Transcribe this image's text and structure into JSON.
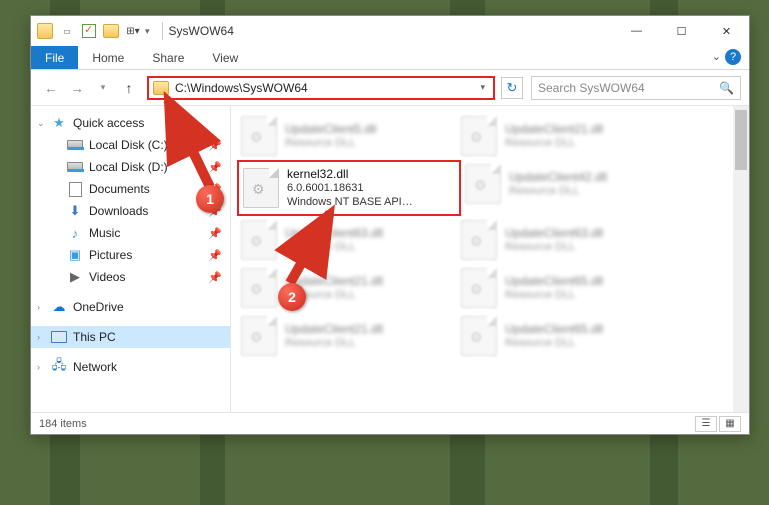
{
  "window": {
    "title": "SysWOW64"
  },
  "ribbon": {
    "file": "File",
    "tabs": [
      "Home",
      "Share",
      "View"
    ]
  },
  "nav": {
    "path": "C:\\Windows\\SysWOW64",
    "search_placeholder": "Search SysWOW64"
  },
  "sidebar": {
    "quick_access": "Quick access",
    "items": [
      {
        "label": "Local Disk (C:)"
      },
      {
        "label": "Local Disk (D:)"
      },
      {
        "label": "Documents"
      },
      {
        "label": "Downloads"
      },
      {
        "label": "Music"
      },
      {
        "label": "Pictures"
      },
      {
        "label": "Videos"
      }
    ],
    "onedrive": "OneDrive",
    "this_pc": "This PC",
    "network": "Network"
  },
  "highlight_file": {
    "name": "kernel32.dll",
    "version": "6.0.6001.18631",
    "desc": "Windows NT BASE API…"
  },
  "blurred_files": [
    {
      "name": "UpdateClient5.dll",
      "desc": "Resource DLL"
    },
    {
      "name": "UpdateClient21.dll",
      "desc": "Resource DLL"
    },
    {
      "name": "UpdateClient42.dll",
      "desc": "Resource DLL"
    },
    {
      "name": "UpdateClient63.dll",
      "desc": "Resource DLL"
    },
    {
      "name": "UpdateClient63.dll",
      "desc": "Resource DLL"
    },
    {
      "name": "UpdateClient21.dll",
      "desc": "Resource DLL"
    },
    {
      "name": "UpdateClient65.dll",
      "desc": "Resource DLL"
    },
    {
      "name": "UpdateClient21.dll",
      "desc": "Resource DLL"
    },
    {
      "name": "UpdateClient65.dll",
      "desc": "Resource DLL"
    }
  ],
  "status": {
    "count": "184 items"
  },
  "annotations": {
    "step1": "1",
    "step2": "2"
  }
}
